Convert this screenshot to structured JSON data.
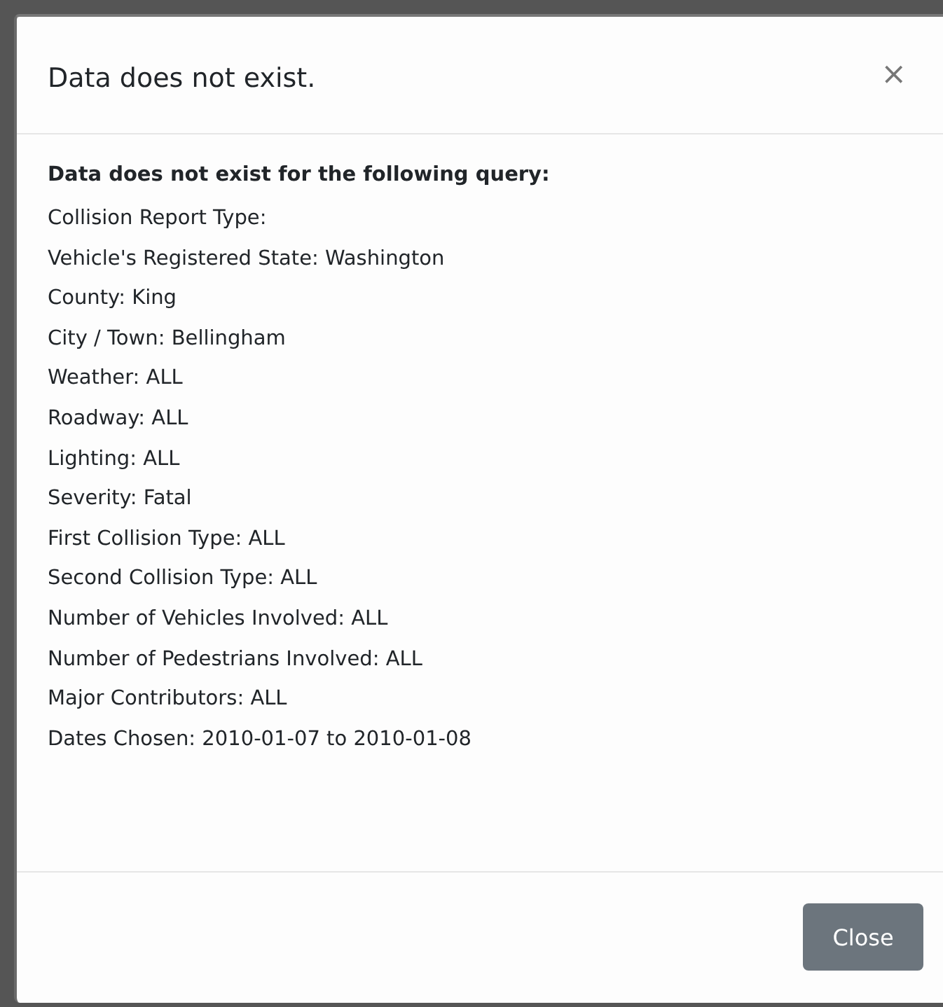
{
  "dialog": {
    "title": "Data does not exist.",
    "close_icon": "×",
    "intro": "Data does not exist for the following query:",
    "lines": [
      "Collision Report Type:",
      "Vehicle's Registered State: Washington",
      "County: King",
      "City / Town: Bellingham",
      "Weather: ALL",
      "Roadway: ALL",
      "Lighting: ALL",
      "Severity: Fatal",
      "First Collision Type: ALL",
      "Second Collision Type: ALL",
      "Number of Vehicles Involved: ALL",
      "Number of Pedestrians Involved: ALL",
      "Major Contributors: ALL",
      "Dates Chosen: 2010-01-07 to 2010-01-08"
    ],
    "buttons": [
      "Close"
    ]
  }
}
